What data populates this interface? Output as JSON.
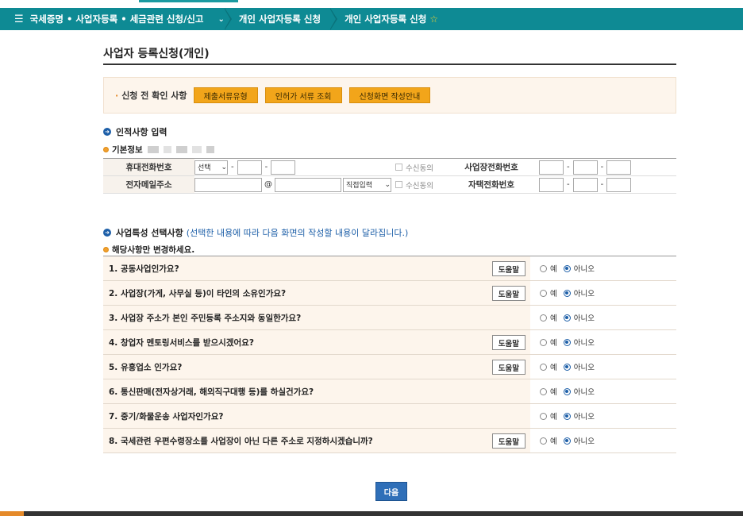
{
  "nav": {
    "menu_label": "국세증명 • 사업자등록 • 세금관련 신청/신고",
    "crumb1": "개인 사업자등록 신청",
    "crumb2": "개인 사업자등록 신청"
  },
  "page_title": "사업자 등록신청(개인)",
  "notice": {
    "label": "신청 전 확인 사항",
    "buttons": [
      "제출서류유형",
      "인허가 서류 조회",
      "신청화면 작성안내"
    ]
  },
  "personal": {
    "section_title": "인적사항 입력",
    "basic_info_label": "기본정보",
    "mobile_label": "휴대전화번호",
    "mobile_select": "선택",
    "receive_label": "수신동의",
    "biz_phone_label": "사업장전화번호",
    "email_label": "전자메일주소",
    "email_at": "@",
    "email_domain_select": "직접입력",
    "home_phone_label": "자택전화번호"
  },
  "features": {
    "section_title": "사업특성 선택사항",
    "section_note": "(선택한 내용에 따라 다음 화면의 작성할 내용이 달라집니다.)",
    "sub_title": "해당사항만 변경하세요.",
    "help_label": "도움말",
    "yes_label": "예",
    "no_label": "아니오",
    "questions": [
      {
        "text": "1. 공동사업인가요?",
        "help": true,
        "answer": "no"
      },
      {
        "text": "2. 사업장(가게, 사무실 등)이 타인의 소유인가요?",
        "help": true,
        "answer": "no"
      },
      {
        "text": "3. 사업장 주소가 본인 주민등록 주소지와 동일한가요?",
        "help": false,
        "answer": "no"
      },
      {
        "text": "4. 창업자 멘토링서비스를 받으시겠어요?",
        "help": true,
        "answer": "no"
      },
      {
        "text": "5. 유흥업소 인가요?",
        "help": true,
        "answer": "no"
      },
      {
        "text": "6. 통신판매(전자상거래, 해외직구대행 등)를 하실건가요?",
        "help": false,
        "answer": "no"
      },
      {
        "text": "7. 중기/화물운송 사업자인가요?",
        "help": false,
        "answer": "no"
      },
      {
        "text": "8. 국세관련 우편수령장소를 사업장이 아닌 다른 주소로 지정하시겠습니까?",
        "help": true,
        "answer": "no"
      }
    ]
  },
  "next_button": "다음"
}
